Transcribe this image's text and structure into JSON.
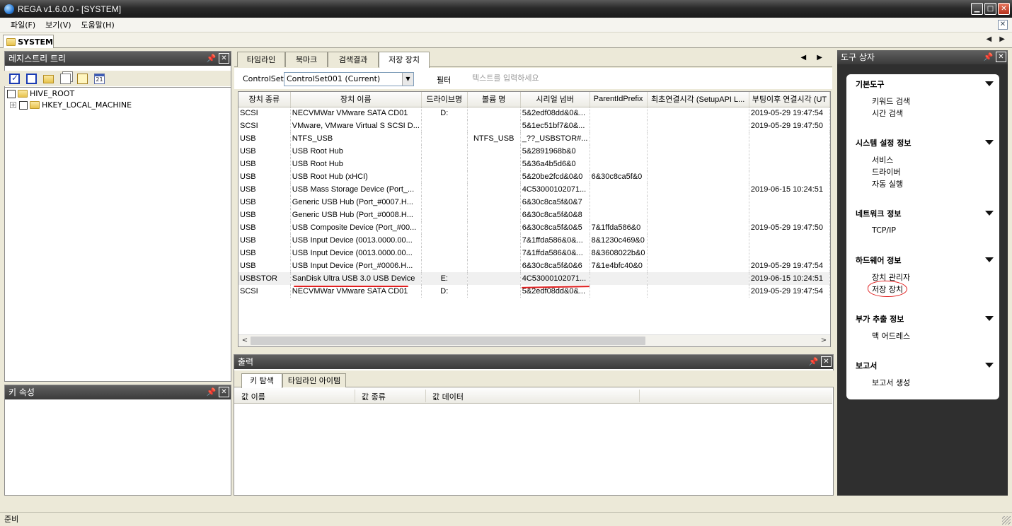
{
  "window": {
    "title": "REGA v1.6.0.0 - [SYSTEM]",
    "min": "▁",
    "max": "□",
    "close": "✕"
  },
  "menu": {
    "items": [
      "파일(F)",
      "보기(V)",
      "도움말(H)"
    ],
    "close": "✕"
  },
  "doc_tab": {
    "label": "SYSTEM",
    "nav": "◀ ▶"
  },
  "left_panel": {
    "title": "레지스트리 트리",
    "tree": [
      {
        "label": "HIVE_ROOT"
      },
      {
        "label": "HKEY_LOCAL_MACHINE",
        "expander": "+"
      }
    ]
  },
  "key_panel": {
    "title": "키 속성"
  },
  "center": {
    "tabs": [
      "타임라인",
      "북마크",
      "검색결과",
      "저장 장치"
    ],
    "active_tab": 3,
    "tab_nav": "◀ ▶",
    "controlset_label": "ControlSet",
    "controlset_value": "ControlSet001 (Current)",
    "filter_label": "필터",
    "filter_placeholder": "텍스트를 입력하세요",
    "columns": [
      "장치 종류",
      "장치 이름",
      "드라이브명",
      "볼륨 명",
      "시리얼 넘버",
      "ParentIdPrefix",
      "최초연결시각 (SetupAPI L...",
      "부팅이후 연결시각 (UT"
    ],
    "rows": [
      [
        "SCSI",
        "NECVMWar VMware SATA CD01",
        "D:",
        "",
        "5&2edf08dd&0&...",
        "",
        "",
        "2019-05-29   19:47:54"
      ],
      [
        "SCSI",
        "VMware, VMware Virtual S SCSI D...",
        "",
        "",
        "5&1ec51bf7&0&...",
        "",
        "",
        "2019-05-29   19:47:50"
      ],
      [
        "USB",
        "NTFS_USB",
        "",
        "NTFS_USB",
        "_??_USBSTOR#...",
        "",
        "",
        ""
      ],
      [
        "USB",
        "USB Root Hub",
        "",
        "",
        "5&2891968b&0",
        "",
        "",
        ""
      ],
      [
        "USB",
        "USB Root Hub",
        "",
        "",
        "5&36a4b5d6&0",
        "",
        "",
        ""
      ],
      [
        "USB",
        "USB Root Hub (xHCI)",
        "",
        "",
        "5&20be2fcd&0&0",
        "6&30c8ca5f&0",
        "",
        ""
      ],
      [
        "USB",
        "USB Mass Storage Device (Port_...",
        "",
        "",
        "4C53000102071...",
        "",
        "",
        "2019-06-15   10:24:51"
      ],
      [
        "USB",
        "Generic USB Hub (Port_#0007.H...",
        "",
        "",
        "6&30c8ca5f&0&7",
        "",
        "",
        ""
      ],
      [
        "USB",
        "Generic USB Hub (Port_#0008.H...",
        "",
        "",
        "6&30c8ca5f&0&8",
        "",
        "",
        ""
      ],
      [
        "USB",
        "USB Composite Device (Port_#00...",
        "",
        "",
        "6&30c8ca5f&0&5",
        "7&1ffda586&0",
        "",
        "2019-05-29   19:47:50"
      ],
      [
        "USB",
        "USB Input Device (0013.0000.00...",
        "",
        "",
        "7&1ffda586&0&...",
        "8&1230c469&0",
        "",
        ""
      ],
      [
        "USB",
        "USB Input Device (0013.0000.00...",
        "",
        "",
        "7&1ffda586&0&...",
        "8&3608022b&0",
        "",
        ""
      ],
      [
        "USB",
        "USB Input Device (Port_#0006.H...",
        "",
        "",
        "6&30c8ca5f&0&6",
        "7&1e4bfc40&0",
        "",
        "2019-05-29   19:47:54"
      ],
      [
        "USBSTOR",
        "SanDisk Ultra USB 3.0 USB Device",
        "E:",
        "",
        "4C53000102071...",
        "",
        "",
        "2019-06-15   10:24:51"
      ],
      [
        "SCSI",
        "NECVMWar VMware SATA CD01",
        "D:",
        "",
        "5&2edf08dd&0&...",
        "",
        "",
        "2019-05-29   19:47:54"
      ]
    ],
    "selected_row": 13
  },
  "output": {
    "title": "출력",
    "tabs": [
      "키 탐색",
      "타임라인 아이템"
    ],
    "columns": [
      "값 이름",
      "값 종류",
      "값 데이터"
    ]
  },
  "toolbox": {
    "title": "도구 상자",
    "groups": [
      {
        "title": "기본도구",
        "items": [
          "키워드 검색",
          "시간 검색"
        ]
      },
      {
        "title": "시스템 설정 정보",
        "items": [
          "서비스",
          "드라이버",
          "자동 실행"
        ]
      },
      {
        "title": "네트워크 정보",
        "items": [
          "TCP/IP"
        ]
      },
      {
        "title": "하드웨어 정보",
        "items": [
          "장치 관리자",
          "저장 장치"
        ]
      },
      {
        "title": "부가 추출 정보",
        "items": [
          "맥 어드레스"
        ]
      },
      {
        "title": "보고서",
        "items": [
          "보고서 생성"
        ]
      }
    ]
  },
  "status": {
    "text": "준비"
  },
  "colors": {
    "header_dark": "#3a3a3a",
    "annotation_red": "#e02020"
  }
}
